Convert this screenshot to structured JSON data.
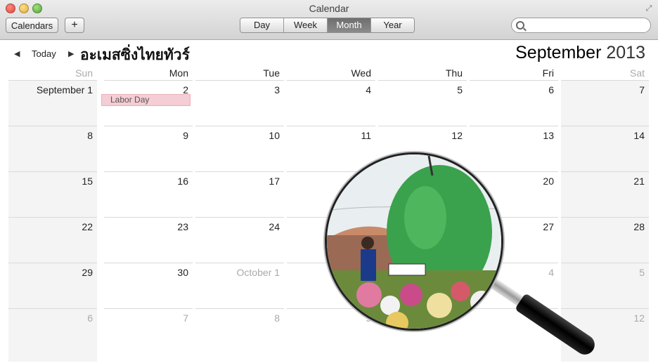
{
  "window": {
    "title": "Calendar"
  },
  "toolbar": {
    "calendars_label": "Calendars",
    "add_label": "+",
    "views": [
      "Day",
      "Week",
      "Month",
      "Year"
    ],
    "active_view": "Month",
    "search_placeholder": ""
  },
  "nav": {
    "today_label": "Today",
    "overlay_text": "อะเมสซิ่งไทยทัวร์"
  },
  "header": {
    "month": "September",
    "year": "2013"
  },
  "weekdays": [
    "Sun",
    "Mon",
    "Tue",
    "Wed",
    "Thu",
    "Fri",
    "Sat"
  ],
  "weeks": [
    [
      {
        "d": "September 1",
        "o": false
      },
      {
        "d": "2",
        "o": false
      },
      {
        "d": "3",
        "o": false
      },
      {
        "d": "4",
        "o": false
      },
      {
        "d": "5",
        "o": false
      },
      {
        "d": "6",
        "o": false
      },
      {
        "d": "7",
        "o": false
      }
    ],
    [
      {
        "d": "8",
        "o": false
      },
      {
        "d": "9",
        "o": false
      },
      {
        "d": "10",
        "o": false
      },
      {
        "d": "11",
        "o": false
      },
      {
        "d": "12",
        "o": false
      },
      {
        "d": "13",
        "o": false
      },
      {
        "d": "14",
        "o": false
      }
    ],
    [
      {
        "d": "15",
        "o": false
      },
      {
        "d": "16",
        "o": false
      },
      {
        "d": "17",
        "o": false
      },
      {
        "d": "",
        "o": false
      },
      {
        "d": "",
        "o": false
      },
      {
        "d": "20",
        "o": false
      },
      {
        "d": "21",
        "o": false
      }
    ],
    [
      {
        "d": "22",
        "o": false
      },
      {
        "d": "23",
        "o": false
      },
      {
        "d": "24",
        "o": false
      },
      {
        "d": "",
        "o": false
      },
      {
        "d": "",
        "o": false
      },
      {
        "d": "27",
        "o": false
      },
      {
        "d": "28",
        "o": false
      }
    ],
    [
      {
        "d": "29",
        "o": false
      },
      {
        "d": "30",
        "o": false
      },
      {
        "d": "October 1",
        "o": true
      },
      {
        "d": "",
        "o": true
      },
      {
        "d": "",
        "o": true
      },
      {
        "d": "4",
        "o": true
      },
      {
        "d": "5",
        "o": true
      }
    ],
    [
      {
        "d": "6",
        "o": true
      },
      {
        "d": "7",
        "o": true
      },
      {
        "d": "8",
        "o": true
      },
      {
        "d": "9",
        "o": true
      },
      {
        "d": "",
        "o": true
      },
      {
        "d": "",
        "o": true
      },
      {
        "d": "12",
        "o": true
      }
    ]
  ],
  "events": [
    {
      "label": "Labor Day",
      "color": "#f5cdd4"
    }
  ],
  "colors": {
    "weekend_header": "#aaaaaa",
    "weekday_header": "#222222",
    "event_bg": "#f5cdd4"
  },
  "icons": {
    "close": "close-icon",
    "minimize": "minimize-icon",
    "zoom": "zoom-icon",
    "search": "search-icon",
    "fullscreen": "fullscreen-icon"
  }
}
